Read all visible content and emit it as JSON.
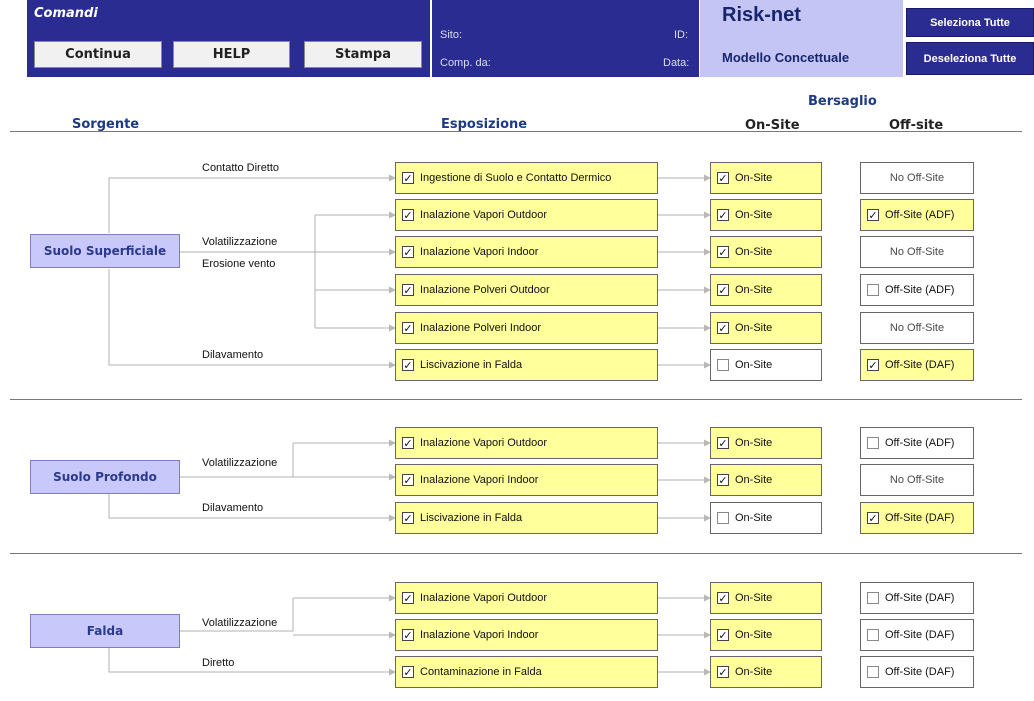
{
  "header": {
    "commands_title": "Comandi",
    "buttons": {
      "continua": "Continua",
      "help": "HELP",
      "stampa": "Stampa"
    },
    "site_label": "Sito:",
    "id_label": "ID:",
    "comp_label": "Comp. da:",
    "data_label": "Data:",
    "app_title": "Risk-net",
    "app_subtitle": "Modello Concettuale",
    "select_all": "Seleziona Tutte",
    "deselect_all": "Deseleziona Tutte"
  },
  "columns": {
    "sorgente": "Sorgente",
    "esposizione": "Esposizione",
    "bersaglio": "Bersaglio",
    "on_site": "On-Site",
    "off_site": "Off-site"
  },
  "check_glyph": "✓",
  "colors": {
    "header_blue": "#2b2c91",
    "source_fill": "#c8c8fa",
    "checked_fill": "#ffff9b"
  },
  "sections": [
    {
      "source": "Suolo Superficiale",
      "labels": {
        "contatto": "Contatto Diretto",
        "volat": "Volatilizzazione",
        "erosione": "Erosione vento",
        "dilav": "Dilavamento"
      },
      "rows": [
        {
          "exp": "Ingestione di Suolo e Contatto Dermico",
          "exp_checked": true,
          "on": "On-Site",
          "on_checked": true,
          "off": "No Off-Site",
          "off_checked": null
        },
        {
          "exp": "Inalazione Vapori Outdoor",
          "exp_checked": true,
          "on": "On-Site",
          "on_checked": true,
          "off": "Off-Site (ADF)",
          "off_checked": true
        },
        {
          "exp": "Inalazione Vapori Indoor",
          "exp_checked": true,
          "on": "On-Site",
          "on_checked": true,
          "off": "No Off-Site",
          "off_checked": null
        },
        {
          "exp": "Inalazione Polveri Outdoor",
          "exp_checked": true,
          "on": "On-Site",
          "on_checked": true,
          "off": "Off-Site (ADF)",
          "off_checked": false
        },
        {
          "exp": "Inalazione Polveri Indoor",
          "exp_checked": true,
          "on": "On-Site",
          "on_checked": true,
          "off": "No Off-Site",
          "off_checked": null
        },
        {
          "exp": "Liscivazione in Falda",
          "exp_checked": true,
          "on": "On-Site",
          "on_checked": false,
          "off": "Off-Site (DAF)",
          "off_checked": true
        }
      ]
    },
    {
      "source": "Suolo Profondo",
      "labels": {
        "volat": "Volatilizzazione",
        "dilav": "Dilavamento"
      },
      "rows": [
        {
          "exp": "Inalazione Vapori Outdoor",
          "exp_checked": true,
          "on": "On-Site",
          "on_checked": true,
          "off": "Off-Site (ADF)",
          "off_checked": false
        },
        {
          "exp": "Inalazione Vapori Indoor",
          "exp_checked": true,
          "on": "On-Site",
          "on_checked": true,
          "off": "No Off-Site",
          "off_checked": null
        },
        {
          "exp": "Liscivazione in Falda",
          "exp_checked": true,
          "on": "On-Site",
          "on_checked": false,
          "off": "Off-Site (DAF)",
          "off_checked": true
        }
      ]
    },
    {
      "source": "Falda",
      "labels": {
        "volat": "Volatilizzazione",
        "diretto": "Diretto"
      },
      "rows": [
        {
          "exp": "Inalazione Vapori Outdoor",
          "exp_checked": true,
          "on": "On-Site",
          "on_checked": true,
          "off": "Off-Site (DAF)",
          "off_checked": false
        },
        {
          "exp": "Inalazione Vapori Indoor",
          "exp_checked": true,
          "on": "On-Site",
          "on_checked": true,
          "off": "Off-Site (DAF)",
          "off_checked": false
        },
        {
          "exp": "Contaminazione in Falda",
          "exp_checked": true,
          "on": "On-Site",
          "on_checked": true,
          "off": "Off-Site (DAF)",
          "off_checked": false
        }
      ]
    }
  ]
}
